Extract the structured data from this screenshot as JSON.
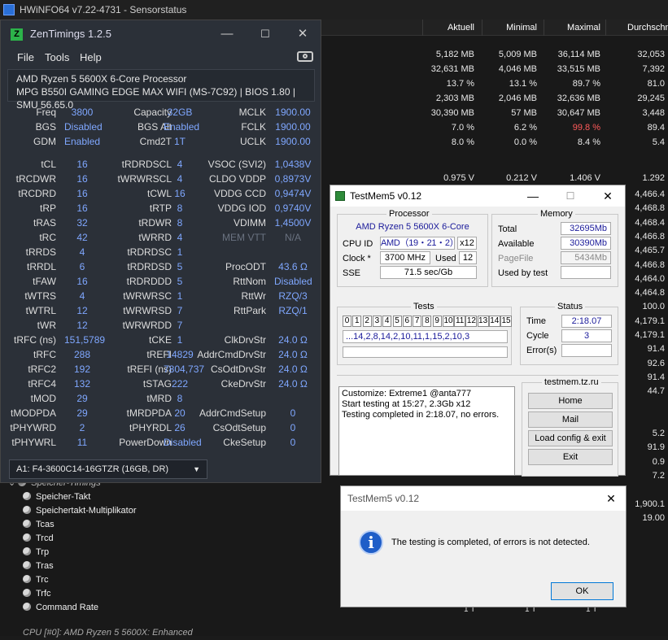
{
  "hwinfo": {
    "title": "HWiNFO64 v7.22-4731 - Sensorstatus",
    "columns": [
      "Aktuell",
      "Minimal",
      "Maximal",
      "Durchschn"
    ],
    "rows": [
      [
        "5,182 MB",
        "5,009 MB",
        "36,114 MB",
        "32,053"
      ],
      [
        "32,631 MB",
        "4,046 MB",
        "33,515 MB",
        "7,392"
      ],
      [
        "13.7 %",
        "13.1 %",
        "89.7 %",
        "81.0"
      ],
      [
        "2,303 MB",
        "2,046 MB",
        "32,636 MB",
        "29,245"
      ],
      [
        "30,390 MB",
        "57 MB",
        "30,647 MB",
        "3,448"
      ],
      [
        "7.0 %",
        "6.2 %",
        "99.8 %",
        "89.4"
      ],
      [
        "8.0 %",
        "0.0 %",
        "8.4 %",
        "5.4"
      ],
      [
        "",
        "",
        "",
        ""
      ],
      [
        "0.975 V",
        "0.212 V",
        "1.406 V",
        "1.292"
      ]
    ],
    "right_col": [
      "4,466.4",
      "4,468.8",
      "4,468.4",
      "4,466.8",
      "4,465.7",
      "4,466.8",
      "4,464.0",
      "4,464.8",
      "100.0",
      "4,179.1",
      "4,179.1",
      "91.4",
      "92.6",
      "91.4",
      "44.7",
      "",
      "",
      "5.2",
      "91.9",
      "0.9",
      "7.2",
      "",
      "1,900.1",
      "19.00"
    ],
    "highlight_color": "#ff5a5a",
    "group_label": "Speicher-Timings",
    "tree_items": [
      "Speicher-Takt",
      "Speichertakt-Multiplikator",
      "Tcas",
      "Trcd",
      "Trp",
      "Tras",
      "Trc",
      "Trfc",
      "Command Rate"
    ],
    "bottom_cut": "CPU [#0]: AMD Ryzen 5 5600X: Enhanced",
    "bottom_vals": [
      "1 T",
      "1 T",
      "1 T"
    ]
  },
  "zen": {
    "title": "ZenTimings 1.2.5",
    "logo": "Z",
    "menu": [
      "File",
      "Tools",
      "Help"
    ],
    "cpu": "AMD Ryzen 5 5600X 6-Core Processor",
    "board": "MPG B550I GAMING EDGE MAX WIFI (MS-7C92) | BIOS 1.80 | SMU 56.65.0",
    "top": [
      [
        "Freq",
        "3800",
        "Capacity",
        "32GB",
        "MCLK",
        "1900.00"
      ],
      [
        "BGS",
        "Disabled",
        "BGS Alt",
        "Enabled",
        "FCLK",
        "1900.00"
      ],
      [
        "GDM",
        "Enabled",
        "Cmd2T",
        "1T",
        "UCLK",
        "1900.00"
      ]
    ],
    "timings": [
      [
        "tCL",
        "16",
        "tRDRDSCL",
        "4",
        "VSOC (SVI2)",
        "1,0438V"
      ],
      [
        "tRCDWR",
        "16",
        "tWRWRSCL",
        "4",
        "CLDO VDDP",
        "0,8973V"
      ],
      [
        "tRCDRD",
        "16",
        "tCWL",
        "16",
        "VDDG CCD",
        "0,9474V"
      ],
      [
        "tRP",
        "16",
        "tRTP",
        "8",
        "VDDG IOD",
        "0,9740V"
      ],
      [
        "tRAS",
        "32",
        "tRDWR",
        "8",
        "VDIMM",
        "1,4500V"
      ],
      [
        "tRC",
        "42",
        "tWRRD",
        "4",
        "MEM VTT",
        "N/A"
      ],
      [
        "tRRDS",
        "4",
        "tRDRDSC",
        "1",
        "",
        ""
      ],
      [
        "tRRDL",
        "6",
        "tRDRDSD",
        "5",
        "ProcODT",
        "43.6 Ω"
      ],
      [
        "tFAW",
        "16",
        "tRDRDDD",
        "5",
        "RttNom",
        "Disabled"
      ],
      [
        "tWTRS",
        "4",
        "tWRWRSC",
        "1",
        "RttWr",
        "RZQ/3"
      ],
      [
        "tWTRL",
        "12",
        "tWRWRSD",
        "7",
        "RttPark",
        "RZQ/1"
      ],
      [
        "tWR",
        "12",
        "tWRWRDD",
        "7",
        "",
        ""
      ],
      [
        "tRFC (ns)",
        "151,5789",
        "tCKE",
        "1",
        "ClkDrvStr",
        "24.0 Ω"
      ],
      [
        "tRFC",
        "288",
        "tREFI",
        "14829",
        "AddrCmdDrvStr",
        "24.0 Ω"
      ],
      [
        "tRFC2",
        "192",
        "tREFI (ns)",
        "7804,737",
        "CsOdtDrvStr",
        "24.0 Ω"
      ],
      [
        "tRFC4",
        "132",
        "tSTAG",
        "222",
        "CkeDrvStr",
        "24.0 Ω"
      ],
      [
        "tMOD",
        "29",
        "tMRD",
        "8",
        "",
        ""
      ],
      [
        "tMODPDA",
        "29",
        "tMRDPDA",
        "20",
        "AddrCmdSetup",
        "0"
      ],
      [
        "tPHYWRD",
        "2",
        "tPHYRDL",
        "26",
        "CsOdtSetup",
        "0"
      ],
      [
        "tPHYWRL",
        "11",
        "PowerDown",
        "Disabled",
        "CkeSetup",
        "0"
      ]
    ],
    "dimm": "A1: F4-3600C14-16GTZR (16GB, DR)"
  },
  "testmem": {
    "title": "TestMem5 v0.12",
    "processor_label": "Processor",
    "processor": "AMD Ryzen 5 5600X 6-Core",
    "cpuid_label": "CPU ID",
    "cpuid": "AMD（19・21・2）",
    "threads": "x12",
    "clock_label": "Clock *",
    "clock": "3700 MHz",
    "used_label": "Used",
    "used": "12",
    "sse_label": "SSE",
    "sse": "71.5 sec/Gb",
    "memory_label": "Memory",
    "total_label": "Total",
    "total": "32695Mb",
    "available_label": "Available",
    "available": "30390Mb",
    "pagefile_label": "PageFile",
    "pagefile": "5434Mb",
    "usedbytest_label": "Used by test",
    "tests_label": "Tests",
    "test_numbers": [
      "0",
      "1",
      "2",
      "3",
      "4",
      "5",
      "6",
      "7",
      "8",
      "9",
      "10",
      "11",
      "12",
      "13",
      "14",
      "15"
    ],
    "sequence": "...14,2,8,14,2,10,11,1,15,2,10,3",
    "status_label": "Status",
    "time_label": "Time",
    "time": "2:18.07",
    "cycle_label": "Cycle",
    "cycle": "3",
    "errors_label": "Error(s)",
    "log": [
      "Customize: Extreme1 @anta777",
      "Start testing at 15:27, 2.3Gb x12",
      "Testing completed in 2:18.07, no errors."
    ],
    "site": "testmem.tz.ru",
    "buttons": [
      "Home",
      "Mail",
      "Load config & exit",
      "Exit"
    ]
  },
  "dialog": {
    "title": "TestMem5 v0.12",
    "message": "The testing is completed, of errors is not detected.",
    "ok": "OK",
    "icon": "i"
  }
}
